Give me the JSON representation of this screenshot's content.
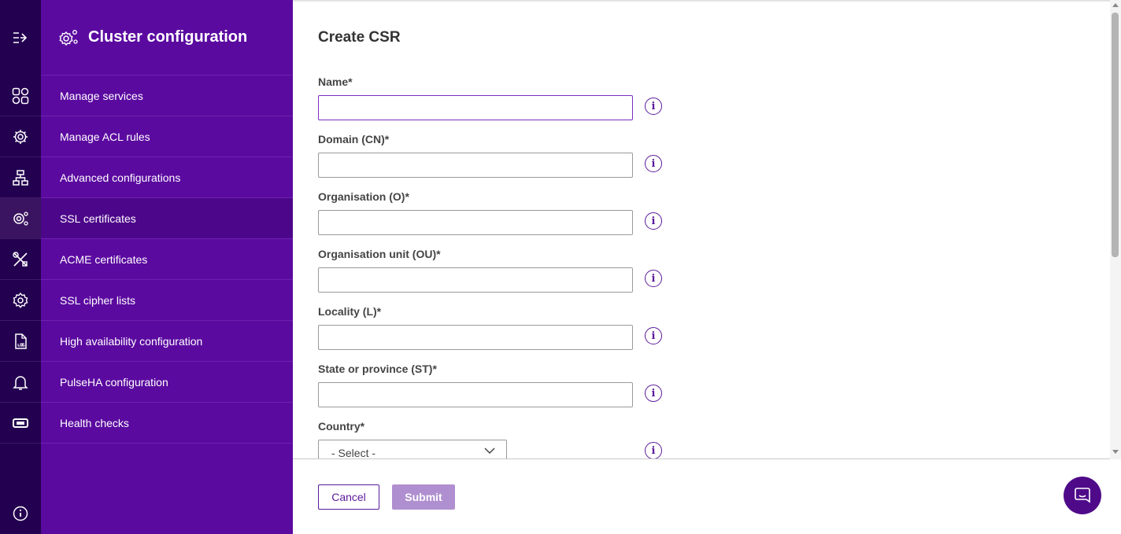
{
  "colors": {
    "rail_bg": "#230050",
    "sidebar_bg": "#5b0aa0",
    "sidebar_active": "#4c068a",
    "accent": "#5b1a9a",
    "submit_disabled": "#b08fd0"
  },
  "rail": {
    "collapse_icon": "collapse-menu-icon",
    "items": [
      {
        "icon": "services-grid-icon"
      },
      {
        "icon": "acl-gear-icon"
      },
      {
        "icon": "network-config-icon"
      },
      {
        "icon": "ssl-gear-icon"
      },
      {
        "icon": "tools-icon"
      },
      {
        "icon": "cipher-gear-icon"
      },
      {
        "icon": "log-file-icon"
      },
      {
        "icon": "bell-icon"
      },
      {
        "icon": "health-ticket-icon"
      }
    ],
    "info_icon": "info-icon"
  },
  "sidebar": {
    "title": "Cluster configuration",
    "header_icon": "cluster-gear-icon",
    "items": [
      {
        "label": "Manage services"
      },
      {
        "label": "Manage ACL rules"
      },
      {
        "label": "Advanced configurations"
      },
      {
        "label": "SSL certificates",
        "active": true
      },
      {
        "label": "ACME certificates"
      },
      {
        "label": "SSL cipher lists"
      },
      {
        "label": "High availability configuration"
      },
      {
        "label": "PulseHA configuration"
      },
      {
        "label": "Health checks"
      }
    ]
  },
  "form": {
    "title": "Create CSR",
    "fields": [
      {
        "label": "Name*",
        "value": "",
        "placeholder": ""
      },
      {
        "label": "Domain (CN)*",
        "value": "",
        "placeholder": ""
      },
      {
        "label": "Organisation (O)*",
        "value": "",
        "placeholder": ""
      },
      {
        "label": "Organisation unit (OU)*",
        "value": "",
        "placeholder": ""
      },
      {
        "label": "Locality (L)*",
        "value": "",
        "placeholder": ""
      },
      {
        "label": "State or province (ST)*",
        "value": "",
        "placeholder": ""
      }
    ],
    "country": {
      "label": "Country*",
      "selected": "- Select -"
    },
    "info_glyph": "i"
  },
  "footer": {
    "cancel_label": "Cancel",
    "submit_label": "Submit"
  },
  "chat": {
    "icon": "chat-bubble-icon"
  }
}
